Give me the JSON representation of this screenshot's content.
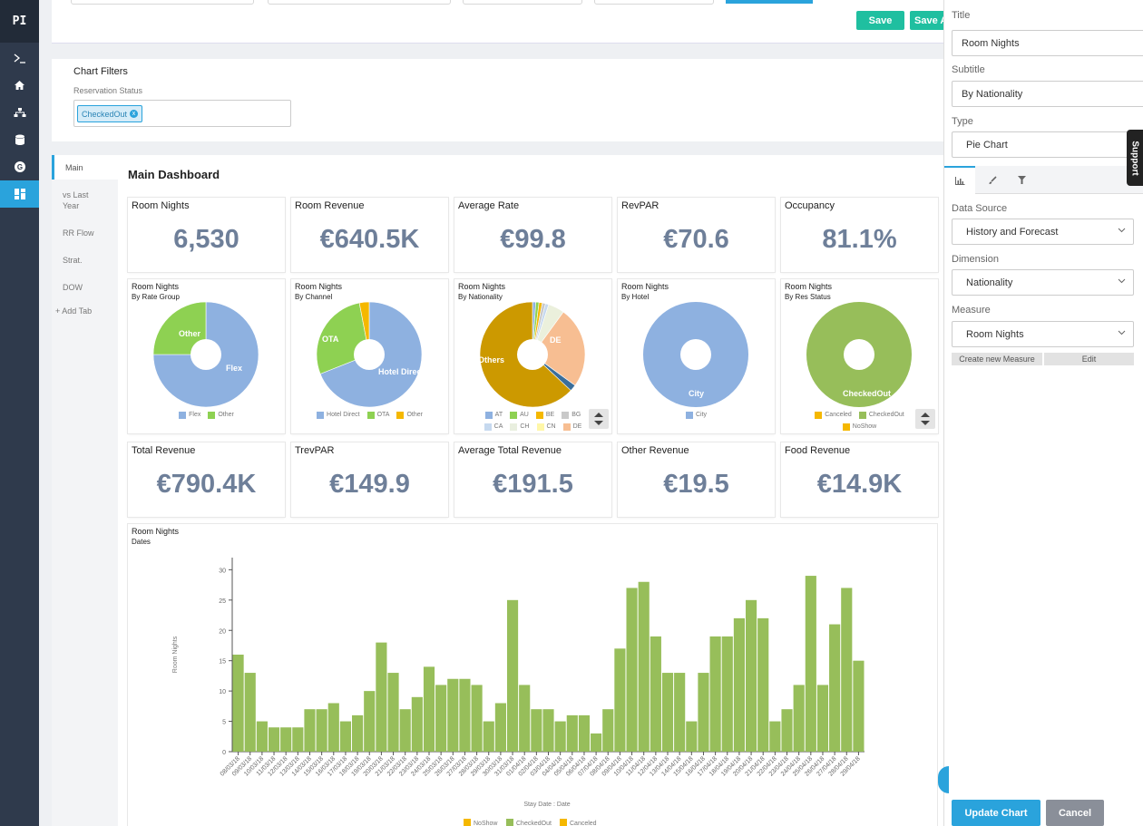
{
  "sidebar": {
    "logo": "PI"
  },
  "toolbar": {
    "save_label": "Save",
    "save_as_label": "Save A"
  },
  "filters": {
    "title": "Chart Filters",
    "label": "Reservation Status",
    "chip": "CheckedOut",
    "chip_remove": "x"
  },
  "tabs": [
    "Main",
    "vs Last Year",
    "RR Flow",
    "Strat.",
    "DOW",
    "+ Add Tab"
  ],
  "dashboard_title": "Main Dashboard",
  "kpis_row1": [
    {
      "title": "Room Nights",
      "value": "6,530"
    },
    {
      "title": "Room Revenue",
      "value": "€640.5K"
    },
    {
      "title": "Average Rate",
      "value": "€99.8"
    },
    {
      "title": "RevPAR",
      "value": "€70.6"
    },
    {
      "title": "Occupancy",
      "value": "81.1%"
    }
  ],
  "kpis_row2": [
    {
      "title": "Total Revenue",
      "value": "€790.4K"
    },
    {
      "title": "TrevPAR",
      "value": "€149.9"
    },
    {
      "title": "Average Total Revenue",
      "value": "€191.5"
    },
    {
      "title": "Other Revenue",
      "value": "€19.5"
    },
    {
      "title": "Food Revenue",
      "value": "€14.9K"
    }
  ],
  "pies": [
    {
      "title": "Room Nights",
      "subtitle": "By Rate Group",
      "slices": [
        {
          "name": "Flex",
          "value": 75,
          "color": "#8eb1e0"
        },
        {
          "name": "Other",
          "value": 25,
          "color": "#8ed152"
        }
      ],
      "legend": [
        {
          "name": "Flex",
          "color": "#8eb1e0"
        },
        {
          "name": "Other",
          "color": "#8ed152"
        }
      ]
    },
    {
      "title": "Room Nights",
      "subtitle": "By Channel",
      "slices": [
        {
          "name": "Hotel Direct",
          "value": 69,
          "color": "#8eb1e0"
        },
        {
          "name": "OTA",
          "value": 28,
          "color": "#8ed152"
        },
        {
          "name": "",
          "value": 3,
          "color": "#f5b800"
        }
      ],
      "legend": [
        {
          "name": "Hotel Direct",
          "color": "#8eb1e0"
        },
        {
          "name": "OTA",
          "color": "#8ed152"
        },
        {
          "name": "Other",
          "color": "#f5b800"
        }
      ]
    },
    {
      "title": "Room Nights",
      "subtitle": "By Nationality",
      "slices": [
        {
          "name": "",
          "value": 1,
          "color": "#8eb1e0"
        },
        {
          "name": "",
          "value": 1,
          "color": "#8ed152"
        },
        {
          "name": "",
          "value": 1,
          "color": "#f5b800"
        },
        {
          "name": "",
          "value": 1,
          "color": "#c9c9c9"
        },
        {
          "name": "",
          "value": 1,
          "color": "#c6d9ef"
        },
        {
          "name": "",
          "value": 5,
          "color": "#ebf0dc"
        },
        {
          "name": "DE",
          "value": 25,
          "color": "#f7be92"
        },
        {
          "name": "",
          "value": 2,
          "color": "#3b6e9a"
        },
        {
          "name": "Others",
          "value": 63,
          "color": "#cc9900"
        }
      ],
      "legend": [
        {
          "name": "AT",
          "color": "#8eb1e0"
        },
        {
          "name": "AU",
          "color": "#8ed152"
        },
        {
          "name": "BE",
          "color": "#f5b800"
        },
        {
          "name": "BG",
          "color": "#c9c9c9"
        },
        {
          "name": "CA",
          "color": "#c6d9ef"
        },
        {
          "name": "CH",
          "color": "#e9efdf"
        },
        {
          "name": "CN",
          "color": "#fff7a8"
        },
        {
          "name": "DE",
          "color": "#f7be92"
        }
      ]
    },
    {
      "title": "Room Nights",
      "subtitle": "By Hotel",
      "slices": [
        {
          "name": "City",
          "value": 100,
          "color": "#8eb1e0"
        }
      ],
      "legend": [
        {
          "name": "City",
          "color": "#8eb1e0"
        }
      ]
    },
    {
      "title": "Room Nights",
      "subtitle": "By Res Status",
      "slices": [
        {
          "name": "CheckedOut",
          "value": 100,
          "color": "#97be5a"
        }
      ],
      "legend": [
        {
          "name": "Canceled",
          "color": "#f5b800"
        },
        {
          "name": "CheckedOut",
          "color": "#97be5a"
        },
        {
          "name": "NoShow",
          "color": "#f5b800"
        }
      ]
    }
  ],
  "chart_data": {
    "type": "bar",
    "title": "Room Nights",
    "subtitle": "Dates",
    "xlabel": "Stay Date : Date",
    "ylabel": "Room Nights",
    "ylim": [
      0,
      32
    ],
    "yticks": [
      0,
      5,
      10,
      15,
      20,
      25,
      30
    ],
    "categories": [
      "08/03/18",
      "09/03/18",
      "10/03/18",
      "11/03/18",
      "12/03/18",
      "13/03/18",
      "14/03/18",
      "15/03/18",
      "16/03/18",
      "17/03/18",
      "18/03/18",
      "19/03/18",
      "20/03/18",
      "21/03/18",
      "22/03/18",
      "23/03/18",
      "24/03/18",
      "25/03/18",
      "26/03/18",
      "27/03/18",
      "28/03/18",
      "29/03/18",
      "30/03/18",
      "31/03/18",
      "01/04/18",
      "02/04/18",
      "03/04/18",
      "04/04/18",
      "05/04/18",
      "06/04/18",
      "07/04/18",
      "08/04/18",
      "09/04/18",
      "10/04/18",
      "11/04/18",
      "12/04/18",
      "13/04/18",
      "14/04/18",
      "15/04/18",
      "16/04/18",
      "17/04/18",
      "18/04/18",
      "19/04/18",
      "20/04/18",
      "21/04/18",
      "22/04/18",
      "23/04/18",
      "24/04/18",
      "25/04/18",
      "26/04/18",
      "27/04/18",
      "28/04/18",
      "29/04/18"
    ],
    "tick_labels": [
      "08/03/18",
      "09/03/18",
      "10/03/18",
      "11/03/18",
      "12/03/18",
      "13/03/18",
      "14/03/18",
      "15/03/18",
      "16/03/18",
      "17/03/18",
      "18/03/18",
      "19/03/18",
      "20/03/18",
      "21/03/18",
      "22/03/18",
      "23/03/18",
      "24/03/18",
      "25/03/18",
      "26/03/18",
      "27/03/18",
      "28/03/18",
      "29/03/18",
      "30/03/18",
      "31/03/18",
      "01/04/18",
      "02/04/18",
      "03/04/18",
      "04/04/18",
      "05/04/18",
      "06/04/18",
      "07/04/18",
      "08/04/18",
      "09/04/18",
      "10/04/18",
      "11/04/18",
      "12/04/18",
      "13/04/18",
      "14/04/18",
      "15/04/18",
      "16/04/18",
      "17/04/18",
      "18/04/18",
      "19/04/18",
      "20/04/18",
      "21/04/18",
      "22/04/18",
      "23/04/18",
      "24/04/18",
      "25/04/18",
      "26/04/18",
      "27/04/18",
      "28/04/18",
      "29/04/18"
    ],
    "series": [
      {
        "name": "CheckedOut",
        "color": "#97be5a",
        "values": [
          16,
          13,
          5,
          4,
          4,
          4,
          7,
          7,
          8,
          5,
          6,
          10,
          18,
          13,
          7,
          9,
          14,
          11,
          12,
          12,
          11,
          5,
          8,
          25,
          11,
          7,
          7,
          5,
          6,
          6,
          3,
          7,
          17,
          27,
          28,
          19,
          13,
          13,
          5,
          13,
          19,
          19,
          22,
          25,
          22,
          5,
          7,
          11,
          29,
          11,
          21,
          27,
          15
        ]
      }
    ],
    "legend": [
      {
        "name": "NoShow",
        "color": "#f5b800"
      },
      {
        "name": "CheckedOut",
        "color": "#97be5a"
      },
      {
        "name": "Canceled",
        "color": "#f5b800"
      }
    ]
  },
  "panel": {
    "title_label": "Title",
    "title_value": "Room Nights",
    "subtitle_label": "Subtitle",
    "subtitle_value": "By Nationality",
    "type_label": "Type",
    "type_value": "Pie Chart",
    "source_label": "Data Source",
    "source_value": "History and Forecast",
    "dimension_label": "Dimension",
    "dimension_value": "Nationality",
    "measure_label": "Measure",
    "measure_value": "Room Nights",
    "create_measure": "Create new Measure",
    "edit": "Edit",
    "update": "Update Chart",
    "cancel": "Cancel",
    "support": "Support"
  },
  "colors": {
    "accent": "#2aa3dc",
    "save": "#1fbfa0",
    "kpi_value": "#6e7f99",
    "sidebar": "#2f3a4c"
  }
}
